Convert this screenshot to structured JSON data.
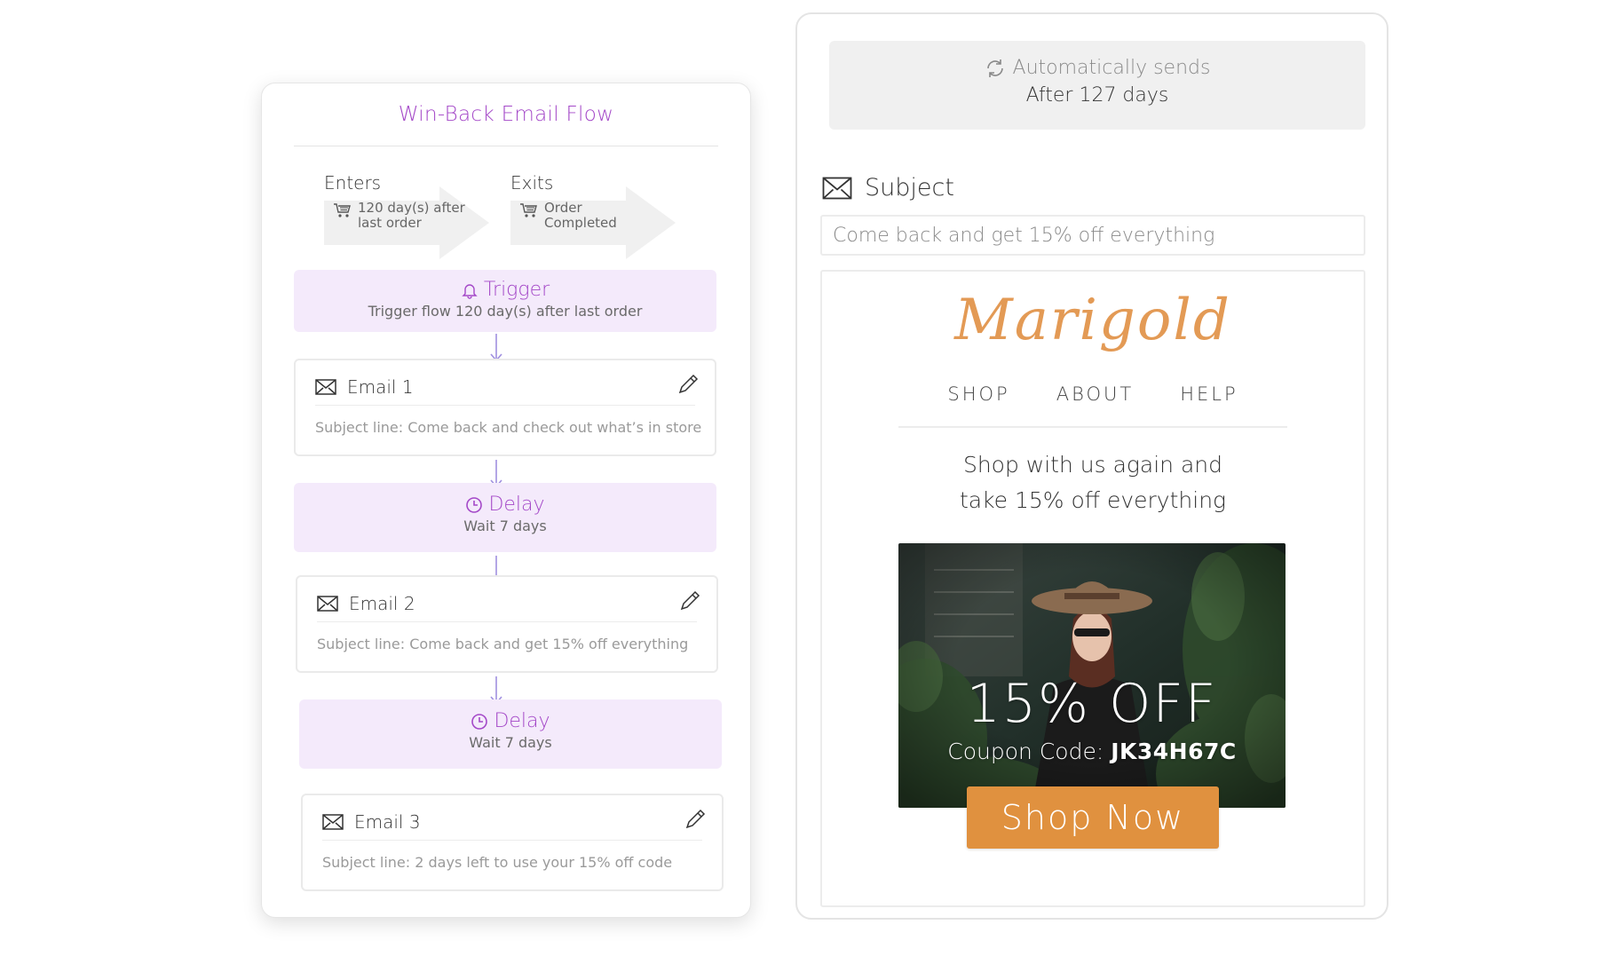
{
  "flow": {
    "title": "Win-Back Email Flow",
    "enters": {
      "label": "Enters",
      "line1": "120 day(s) after",
      "line2": "last order"
    },
    "exits": {
      "label": "Exits",
      "line1": "Order",
      "line2": "Completed"
    },
    "trigger": {
      "title": "Trigger",
      "subtitle": "Trigger flow 120 day(s) after last order"
    },
    "steps": [
      {
        "type": "email",
        "name": "Email 1",
        "subject": "Subject line: Come back and check out what’s in store"
      },
      {
        "type": "delay",
        "title": "Delay",
        "subtitle": "Wait 7 days"
      },
      {
        "type": "email",
        "name": "Email 2",
        "subject": "Subject line: Come back and get 15% off everything"
      },
      {
        "type": "delay",
        "title": "Delay",
        "subtitle": "Wait 7 days"
      },
      {
        "type": "email",
        "name": "Email 3",
        "subject": "Subject line: 2 days left to use your 15% off code"
      }
    ]
  },
  "editor": {
    "auto_send_label": "Automatically sends",
    "auto_send_value": "After 127 days",
    "subject_label": "Subject",
    "subject_value": "Come back and get 15% off everything"
  },
  "preview": {
    "brand": "Marigold",
    "nav": [
      "SHOP",
      "ABOUT",
      "HELP"
    ],
    "headline_line1": "Shop with us again and",
    "headline_line2": "take 15% off everything",
    "offer": "15% OFF",
    "coupon_label": "Coupon Code:",
    "coupon_code": "JK34H67C",
    "cta": "Shop Now"
  },
  "colors": {
    "accent_purple": "#a448c8",
    "step_background": "#f4eafb",
    "brand_orange": "#e39a55",
    "cta_orange": "#e0913f"
  },
  "icons": [
    "cart-icon",
    "bell-icon",
    "envelope-icon",
    "pencil-icon",
    "clock-icon",
    "refresh-icon",
    "down-arrow-icon"
  ]
}
